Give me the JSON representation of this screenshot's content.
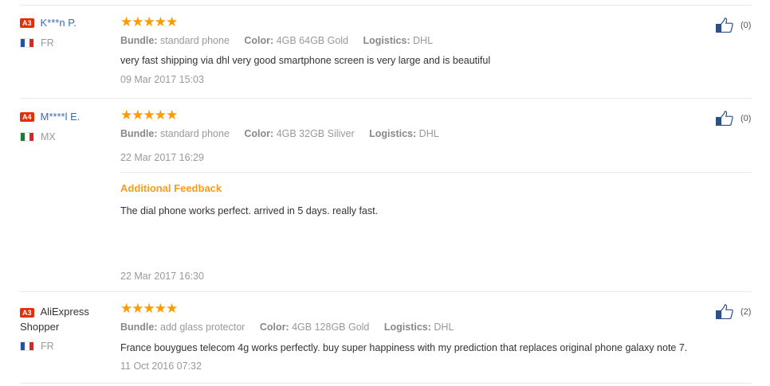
{
  "reviews": [
    {
      "badge": "A3",
      "name": "K***n P.",
      "country": "FR",
      "flag_colors": [
        "#2d4fa3",
        "#ffffff",
        "#e0261f"
      ],
      "stars": [
        "★",
        "★",
        "★",
        "★",
        "★"
      ],
      "rating": 5,
      "attrs": [
        {
          "label": "Bundle:",
          "value": "standard phone"
        },
        {
          "label": "Color:",
          "value": "4GB 64GB Gold"
        },
        {
          "label": "Logistics:",
          "value": "DHL"
        }
      ],
      "text": "very fast shipping via dhl very good smartphone screen is very large and is beautiful",
      "date": "09 Mar 2017 15:03",
      "likes": "(0)"
    },
    {
      "badge": "A4",
      "name": "M****l E.",
      "country": "MX",
      "flag_colors": [
        "#1f7a3a",
        "#ffffff",
        "#d9262d"
      ],
      "stars": [
        "★",
        "★",
        "★",
        "★",
        "★"
      ],
      "rating": 5,
      "attrs": [
        {
          "label": "Bundle:",
          "value": "standard phone"
        },
        {
          "label": "Color:",
          "value": "4GB 32GB Siliver"
        },
        {
          "label": "Logistics:",
          "value": "DHL"
        }
      ],
      "date": "22 Mar 2017 16:29",
      "additional_title": "Additional Feedback",
      "additional_text": "The dial phone works perfect. arrived in 5 days. really fast.",
      "additional_date": "22 Mar 2017 16:30",
      "likes": "(0)"
    },
    {
      "badge": "A3",
      "name": "AliExpress Shopper",
      "country": "FR",
      "flag_colors": [
        "#2d4fa3",
        "#ffffff",
        "#e0261f"
      ],
      "stars": [
        "★",
        "★",
        "★",
        "★",
        "★"
      ],
      "rating": 5,
      "attrs": [
        {
          "label": "Bundle:",
          "value": "add glass protector"
        },
        {
          "label": "Color:",
          "value": "4GB 128GB Gold"
        },
        {
          "label": "Logistics:",
          "value": "DHL"
        }
      ],
      "text": "France bouygues telecom 4g works perfectly. buy super happiness with my prediction that replaces original phone galaxy note 7.",
      "date": "11 Oct 2016 07:32",
      "likes": "(2)"
    }
  ],
  "colors": {
    "badge": "#e62e04",
    "username": "#3a6ab8",
    "star": "#ff9a00",
    "feedback_title": "#f89c1c",
    "thumb": "#2d4f8a"
  },
  "icons": {
    "like": "thumbs-up-icon",
    "star": "star-icon",
    "flag": "flag-icon"
  }
}
